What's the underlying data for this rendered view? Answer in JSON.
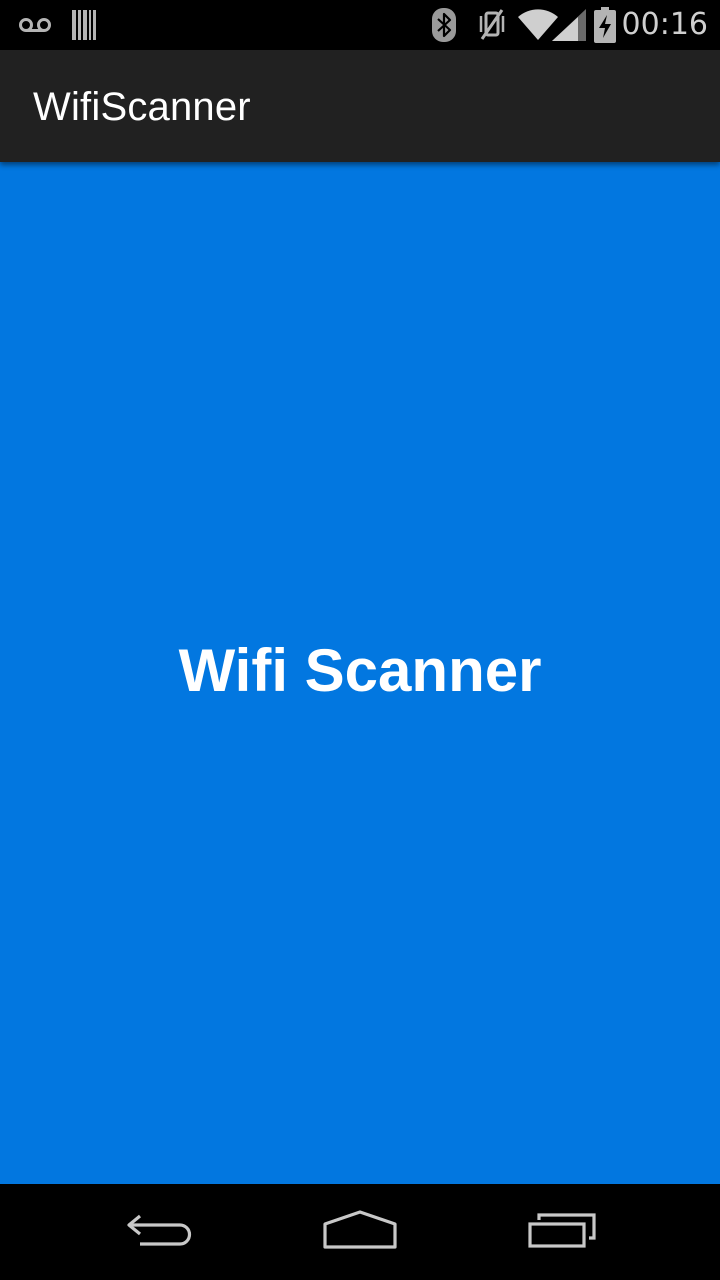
{
  "status_bar": {
    "icons": [
      "voicemail-icon",
      "barcode-icon",
      "bluetooth-icon",
      "vibrate-off-icon",
      "wifi-icon",
      "signal-icon",
      "battery-charging-icon"
    ],
    "time": "00:16"
  },
  "app_bar": {
    "title": "WifiScanner",
    "background": "#212121"
  },
  "main": {
    "title": "Wifi Scanner",
    "background": "#0277e0"
  },
  "nav_bar": {
    "buttons": [
      "back-icon",
      "home-icon",
      "recent-apps-icon"
    ]
  }
}
